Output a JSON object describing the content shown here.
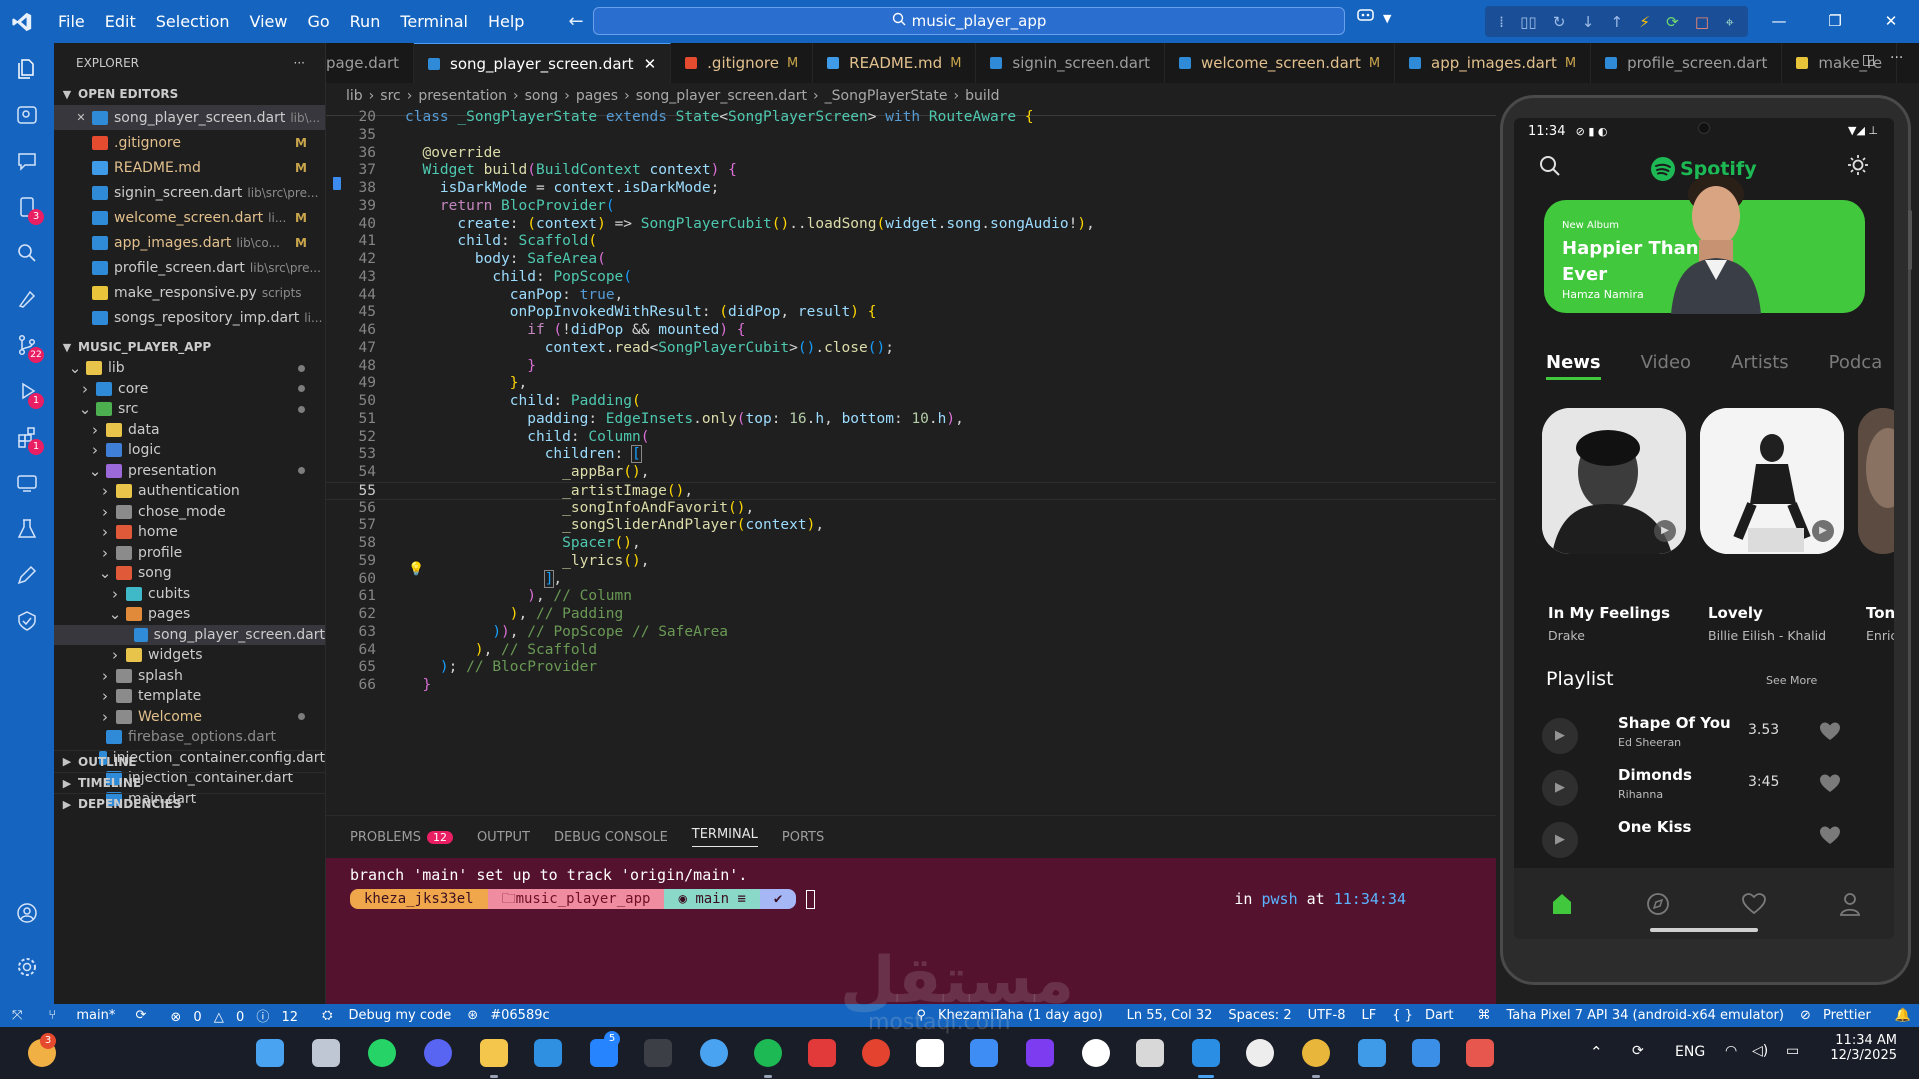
{
  "title_bar": {
    "menu": [
      "File",
      "Edit",
      "Selection",
      "View",
      "Go",
      "Run",
      "Terminal",
      "Help"
    ],
    "search_text": "music_player_app"
  },
  "explorer": {
    "header": "EXPLORER",
    "open_editors_label": "OPEN EDITORS",
    "open_editors": [
      {
        "name": "song_player_screen.dart",
        "path": "lib\\...",
        "mark": "",
        "color": "#2f8bd8"
      },
      {
        "name": ".gitignore",
        "path": "",
        "mark": "M",
        "color": "#e54b2e"
      },
      {
        "name": "README.md",
        "path": "",
        "mark": "M",
        "color": "#3f9be8"
      },
      {
        "name": "signin_screen.dart",
        "path": "lib\\src\\pre...",
        "mark": "",
        "color": "#2f8bd8"
      },
      {
        "name": "welcome_screen.dart",
        "path": "li...",
        "mark": "M",
        "color": "#2f8bd8"
      },
      {
        "name": "app_images.dart",
        "path": "lib\\co...",
        "mark": "M",
        "color": "#2f8bd8"
      },
      {
        "name": "profile_screen.dart",
        "path": "lib\\src\\pre...",
        "mark": "",
        "color": "#2f8bd8"
      },
      {
        "name": "make_responsive.py",
        "path": "scripts",
        "mark": "",
        "color": "#e8c43a"
      },
      {
        "name": "songs_repository_imp.dart",
        "path": "li...",
        "mark": "",
        "color": "#2f8bd8"
      }
    ],
    "project_label": "MUSIC_PLAYER_APP",
    "tree": [
      {
        "name": "lib",
        "depth": 1,
        "open": true,
        "folder": true,
        "dot": true,
        "color": "#e9c44a"
      },
      {
        "name": "core",
        "depth": 2,
        "open": false,
        "folder": true,
        "dot": true,
        "color": "#2f8bd8"
      },
      {
        "name": "src",
        "depth": 2,
        "open": true,
        "folder": true,
        "dot": true,
        "color": "#4caf50"
      },
      {
        "name": "data",
        "depth": 3,
        "open": false,
        "folder": true,
        "dot": false,
        "color": "#e9c44a"
      },
      {
        "name": "logic",
        "depth": 3,
        "open": false,
        "folder": true,
        "dot": false,
        "color": "#3f7fd8"
      },
      {
        "name": "presentation",
        "depth": 3,
        "open": true,
        "folder": true,
        "dot": true,
        "color": "#9c6ad8"
      },
      {
        "name": "authentication",
        "depth": 4,
        "open": false,
        "folder": true,
        "dot": false,
        "color": "#e9c44a"
      },
      {
        "name": "chose_mode",
        "depth": 4,
        "open": false,
        "folder": true,
        "dot": false,
        "color": "#8b8b8b"
      },
      {
        "name": "home",
        "depth": 4,
        "open": false,
        "folder": true,
        "dot": false,
        "color": "#e05a3a"
      },
      {
        "name": "profile",
        "depth": 4,
        "open": false,
        "folder": true,
        "dot": false,
        "color": "#8b8b8b"
      },
      {
        "name": "song",
        "depth": 4,
        "open": true,
        "folder": true,
        "dot": false,
        "color": "#e05a3a"
      },
      {
        "name": "cubits",
        "depth": 5,
        "open": false,
        "folder": true,
        "dot": false,
        "color": "#3fb8c8"
      },
      {
        "name": "pages",
        "depth": 5,
        "open": true,
        "folder": true,
        "dot": false,
        "color": "#e08a3a"
      },
      {
        "name": "song_player_screen.dart",
        "depth": 6,
        "open": false,
        "folder": false,
        "dot": false,
        "color": "#2f8bd8"
      },
      {
        "name": "widgets",
        "depth": 5,
        "open": false,
        "folder": true,
        "dot": false,
        "color": "#e9c44a"
      },
      {
        "name": "splash",
        "depth": 4,
        "open": false,
        "folder": true,
        "dot": false,
        "color": "#8b8b8b"
      },
      {
        "name": "template",
        "depth": 4,
        "open": false,
        "folder": true,
        "dot": false,
        "color": "#8b8b8b"
      },
      {
        "name": "Welcome",
        "depth": 4,
        "open": false,
        "folder": true,
        "dot": true,
        "color": "#8b8b8b"
      },
      {
        "name": "firebase_options.dart",
        "depth": 3,
        "open": false,
        "folder": false,
        "dot": false,
        "color": "#2f8bd8"
      },
      {
        "name": "injection_container.config.dart",
        "depth": 3,
        "open": false,
        "folder": false,
        "dot": false,
        "color": "#2f8bd8"
      },
      {
        "name": "injection_container.dart",
        "depth": 3,
        "open": false,
        "folder": false,
        "dot": false,
        "color": "#2f8bd8"
      },
      {
        "name": "main.dart",
        "depth": 3,
        "open": false,
        "folder": false,
        "dot": false,
        "color": "#2f8bd8"
      }
    ],
    "bottom_sections": [
      "OUTLINE",
      "TIMELINE",
      "DEPENDENCIES"
    ]
  },
  "tabs": [
    {
      "label": "page.dart",
      "mark": "",
      "active": false,
      "color": "#2f8bd8"
    },
    {
      "label": "song_player_screen.dart",
      "mark": "",
      "active": true,
      "color": "#2f8bd8"
    },
    {
      "label": ".gitignore",
      "mark": "M",
      "active": false,
      "color": "#e54b2e"
    },
    {
      "label": "README.md",
      "mark": "M",
      "active": false,
      "color": "#3f9be8"
    },
    {
      "label": "signin_screen.dart",
      "mark": "",
      "active": false,
      "color": "#2f8bd8"
    },
    {
      "label": "welcome_screen.dart",
      "mark": "M",
      "active": false,
      "color": "#2f8bd8"
    },
    {
      "label": "app_images.dart",
      "mark": "M",
      "active": false,
      "color": "#2f8bd8"
    },
    {
      "label": "profile_screen.dart",
      "mark": "",
      "active": false,
      "color": "#2f8bd8"
    },
    {
      "label": "make_re",
      "mark": "",
      "active": false,
      "color": "#e8c43a"
    }
  ],
  "breadcrumb": [
    "lib",
    "src",
    "presentation",
    "song",
    "pages",
    "song_player_screen.dart",
    "_SongPlayerState",
    "build"
  ],
  "editor": {
    "current_line": 55,
    "lines": [
      {
        "n": 20,
        "html": "<span class='kw'>class</span> <span class='ty'>_SongPlayerState</span> <span class='kw'>extends</span> <span class='ty'>State</span><span class='pu'>&lt;</span><span class='ty'>SongPlayerScreen</span><span class='pu'>&gt;</span> <span class='kw'>with</span> <span class='ty'>RouteAware</span> <span class='br1'>{</span>"
      },
      {
        "n": 35,
        "html": ""
      },
      {
        "n": 36,
        "html": "  <span class='fn'>@override</span>"
      },
      {
        "n": 37,
        "html": "  <span class='ty'>Widget</span> <span class='fn'>build</span><span class='br2'>(</span><span class='ty'>BuildContext</span> <span class='va'>context</span><span class='br2'>)</span> <span class='br2'>{</span>"
      },
      {
        "n": 38,
        "html": "    <span class='va'>isDarkMode</span> <span class='pu'>=</span> <span class='va'>context</span><span class='pu'>.</span><span class='va'>isDarkMode</span><span class='pu'>;</span>"
      },
      {
        "n": 39,
        "html": "    <span class='kw2'>return</span> <span class='ty'>BlocProvider</span><span class='br3'>(</span>"
      },
      {
        "n": 40,
        "html": "      <span class='va'>create</span><span class='pu'>:</span> <span class='br1'>(</span><span class='va'>context</span><span class='br1'>)</span> <span class='pu'>=&gt;</span> <span class='ty'>SongPlayerCubit</span><span class='br1'>()</span><span class='pu'>..</span><span class='fn'>loadSong</span><span class='br1'>(</span><span class='va'>widget</span><span class='pu'>.</span><span class='va'>song</span><span class='pu'>.</span><span class='va'>songAudio</span><span class='pu'>!</span><span class='br1'>)</span><span class='pu'>,</span>"
      },
      {
        "n": 41,
        "html": "      <span class='va'>child</span><span class='pu'>:</span> <span class='ty'>Scaffold</span><span class='br1'>(</span>"
      },
      {
        "n": 42,
        "html": "        <span class='va'>body</span><span class='pu'>:</span> <span class='ty'>SafeArea</span><span class='br2'>(</span>"
      },
      {
        "n": 43,
        "html": "          <span class='va'>child</span><span class='pu'>:</span> <span class='ty'>PopScope</span><span class='br3'>(</span>"
      },
      {
        "n": 44,
        "html": "            <span class='va'>canPop</span><span class='pu'>:</span> <span class='kw'>true</span><span class='pu'>,</span>"
      },
      {
        "n": 45,
        "html": "            <span class='va'>onPopInvokedWithResult</span><span class='pu'>:</span> <span class='br1'>(</span><span class='va'>didPop</span><span class='pu'>,</span> <span class='va'>result</span><span class='br1'>)</span> <span class='br1'>{</span>"
      },
      {
        "n": 46,
        "html": "              <span class='kw2'>if</span> <span class='br2'>(</span><span class='pu'>!</span><span class='va'>didPop</span> <span class='pu'>&amp;&amp;</span> <span class='va'>mounted</span><span class='br2'>)</span> <span class='br2'>{</span>"
      },
      {
        "n": 47,
        "html": "                <span class='va'>context</span><span class='pu'>.</span><span class='fn'>read</span><span class='pu'>&lt;</span><span class='ty'>SongPlayerCubit</span><span class='pu'>&gt;</span><span class='br3'>()</span><span class='pu'>.</span><span class='fn'>close</span><span class='br3'>()</span><span class='pu'>;</span>"
      },
      {
        "n": 48,
        "html": "              <span class='br2'>}</span>"
      },
      {
        "n": 49,
        "html": "            <span class='br1'>}</span><span class='pu'>,</span>"
      },
      {
        "n": 50,
        "html": "            <span class='va'>child</span><span class='pu'>:</span> <span class='ty'>Padding</span><span class='br1'>(</span>"
      },
      {
        "n": 51,
        "html": "              <span class='va'>padding</span><span class='pu'>:</span> <span class='ty'>EdgeInsets</span><span class='pu'>.</span><span class='fn'>only</span><span class='br2'>(</span><span class='va'>top</span><span class='pu'>:</span> <span class='nu'>16</span><span class='pu'>.</span><span class='va'>h</span><span class='pu'>,</span> <span class='va'>bottom</span><span class='pu'>:</span> <span class='nu'>10</span><span class='pu'>.</span><span class='va'>h</span><span class='br2'>)</span><span class='pu'>,</span>"
      },
      {
        "n": 52,
        "html": "              <span class='va'>child</span><span class='pu'>:</span> <span class='ty'>Column</span><span class='br2'>(</span>"
      },
      {
        "n": 53,
        "html": "                <span class='va'>children</span><span class='pu'>:</span> <span class='br3' style='outline:1px solid #888'>[</span>"
      },
      {
        "n": 54,
        "html": "                  <span class='fn'>_appBar</span><span class='br1'>()</span><span class='pu'>,</span>"
      },
      {
        "n": 55,
        "html": "                  <span class='fn'>_artistImage</span><span class='br1'>()</span><span class='pu'>,</span>"
      },
      {
        "n": 56,
        "html": "                  <span class='fn'>_songInfoAndFavorit</span><span class='br1'>()</span><span class='pu'>,</span>"
      },
      {
        "n": 57,
        "html": "                  <span class='fn'>_songSliderAndPlayer</span><span class='br1'>(</span><span class='va'>context</span><span class='br1'>)</span><span class='pu'>,</span>"
      },
      {
        "n": 58,
        "html": "                  <span class='ty'>Spacer</span><span class='br1'>()</span><span class='pu'>,</span>"
      },
      {
        "n": 59,
        "html": "                  <span class='fn'>_lyrics</span><span class='br1'>()</span><span class='pu'>,</span>"
      },
      {
        "n": 60,
        "html": "                <span class='br3' style='outline:1px solid #888'>]</span><span class='pu'>,</span>"
      },
      {
        "n": 61,
        "html": "              <span class='br2'>)</span><span class='pu'>,</span> <span class='cm'>// Column</span>"
      },
      {
        "n": 62,
        "html": "            <span class='br1'>)</span><span class='pu'>,</span> <span class='cm'>// Padding</span>"
      },
      {
        "n": 63,
        "html": "          <span class='br3'>)</span><span class='br2'>)</span><span class='pu'>,</span> <span class='cm'>// PopScope // SafeArea</span>"
      },
      {
        "n": 64,
        "html": "        <span class='br1'>)</span><span class='pu'>,</span> <span class='cm'>// Scaffold</span>"
      },
      {
        "n": 65,
        "html": "    <span class='br3'>)</span><span class='pu'>;</span> <span class='cm'>// BlocProvider</span>"
      },
      {
        "n": 66,
        "html": "  <span class='br2'>}</span>"
      }
    ]
  },
  "panel": {
    "tabs": [
      "PROBLEMS",
      "OUTPUT",
      "DEBUG CONSOLE",
      "TERMINAL",
      "PORTS"
    ],
    "problems_count": "12",
    "active_tab": "TERMINAL",
    "terminal_line": "branch 'main' set up to track 'origin/main'.",
    "prompt_user": "kheza_jks33el",
    "prompt_dir": "music_player_app",
    "prompt_branch": "main ≡",
    "prompt_check": "✔",
    "shell_in": "in",
    "shell": "pwsh",
    "shell_at": "at",
    "time": "11:34:34"
  },
  "phone": {
    "status_time": "11:34",
    "app_name": "Spotify",
    "banner": {
      "tag": "New Album",
      "title": "Happier Than Ever",
      "artist": "Hamza Namira"
    },
    "categories": [
      "News",
      "Video",
      "Artists",
      "Podca"
    ],
    "albums": [
      {
        "title": "In My Feelings",
        "artist": "Drake"
      },
      {
        "title": "Lovely",
        "artist": "Billie Eilish - Khalid"
      },
      {
        "title": "Toni",
        "artist": "Enric"
      }
    ],
    "playlist_title": "Playlist",
    "see_more": "See More",
    "playlist": [
      {
        "name": "Shape Of You",
        "artist": "Ed Sheeran",
        "duration": "3.53"
      },
      {
        "name": "Dimonds",
        "artist": "Rihanna",
        "duration": "3:45"
      },
      {
        "name": "One Kiss",
        "artist": "",
        "duration": ""
      }
    ],
    "accent": "#42c83c"
  },
  "status_bar": {
    "branch": "main*",
    "errors": "0",
    "warnings": "0",
    "info": "12",
    "debug": "Debug my code",
    "commit": "#06589c",
    "blame": "KhezamiTaha (1 day ago)",
    "position": "Ln 55, Col 32",
    "spaces": "Spaces: 2",
    "encoding": "UTF-8",
    "eol": "LF",
    "language": "Dart",
    "device": "Taha Pixel 7 API 34 (android-x64 emulator)",
    "formatter": "Prettier"
  },
  "taskbar": {
    "lang": "ENG",
    "time": "11:34 AM",
    "date": "12/3/2025",
    "badge_left": "3",
    "badge_jira": "5"
  },
  "watermark": {
    "arabic": "مستقل",
    "latin": "mostaql.com"
  }
}
